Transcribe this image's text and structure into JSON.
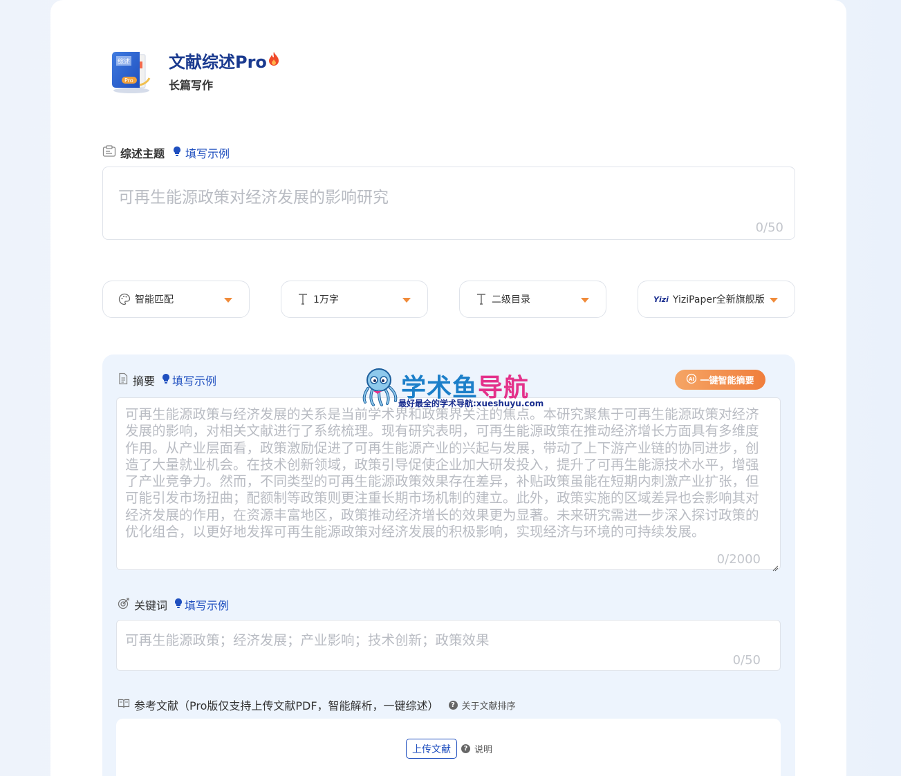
{
  "app": {
    "title": "文献综述Pro",
    "subtitle": "长篇写作",
    "logo_text": "综述",
    "logo_badge": "Pro"
  },
  "topic": {
    "label": "综述主题",
    "example": "填写示例",
    "placeholder": "可再生能源政策对经济发展的影响研究",
    "counter": "0/50"
  },
  "selects": [
    {
      "label": "智能匹配",
      "icon": "palette-icon"
    },
    {
      "label": "1万字",
      "icon": "text-size-icon"
    },
    {
      "label": "二级目录",
      "icon": "text-size-icon"
    },
    {
      "label": "YiziPaper全新旗舰版",
      "icon": "yizi-logo-icon",
      "icon_text": "Yizi"
    }
  ],
  "abstract": {
    "label": "摘要",
    "example": "填写示例",
    "ai_button": "一键智能摘要",
    "placeholder": "可再生能源政策与经济发展的关系是当前学术界和政策界关注的焦点。本研究聚焦于可再生能源政策对经济发展的影响，对相关文献进行了系统梳理。现有研究表明，可再生能源政策在推动经济增长方面具有多维度作用。从产业层面看，政策激励促进了可再生能源产业的兴起与发展，带动了上下游产业链的协同进步，创造了大量就业机会。在技术创新领域，政策引导促使企业加大研发投入，提升了可再生能源技术水平，增强了产业竞争力。然而，不同类型的可再生能源政策效果存在差异，补贴政策虽能在短期内刺激产业扩张，但可能引发市场扭曲；配额制等政策则更注重长期市场机制的建立。此外，政策实施的区域差异也会影响其对经济发展的作用，在资源丰富地区，政策推动经济增长的效果更为显著。未来研究需进一步深入探讨政策的优化组合，以更好地发挥可再生能源政策对经济发展的积极影响，实现经济与环境的可持续发展。",
    "counter": "0/2000"
  },
  "keywords": {
    "label": "关键词",
    "example": "填写示例",
    "placeholder": "可再生能源政策；经济发展；产业影响；技术创新；政策效果",
    "counter": "0/50"
  },
  "references": {
    "label": "参考文献（Pro版仅支持上传文献PDF，智能解析，一键综述）",
    "sort_help": "关于文献排序",
    "upload_button": "上传文献",
    "explain": "说明"
  },
  "watermark": {
    "title_a": "学术鱼",
    "title_b": "导航",
    "subtitle": "最好最全的学术导航:xueshuyu.com"
  },
  "colors": {
    "brand": "#1a3a8f",
    "link": "#1f4fbf",
    "accent": "#f07e3c",
    "panel": "#edf4fd"
  }
}
